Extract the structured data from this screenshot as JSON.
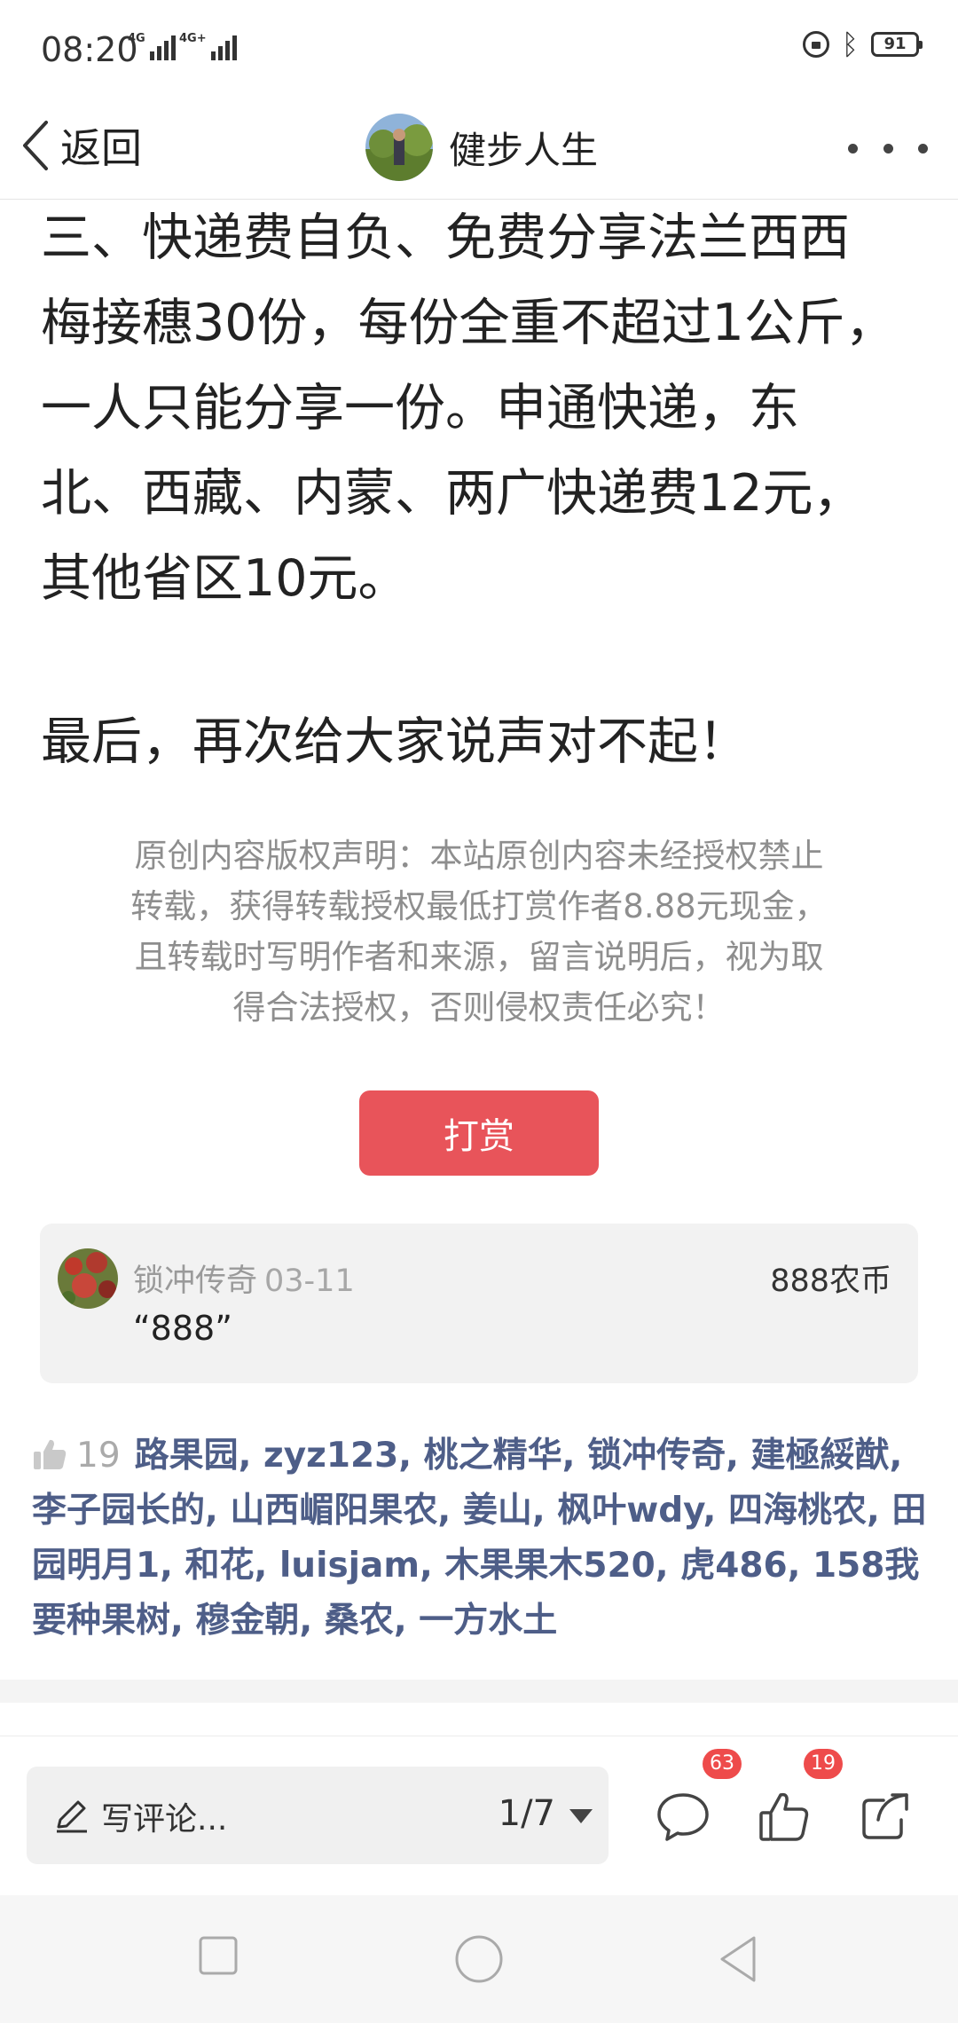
{
  "status_bar": {
    "time": "08:20",
    "net1": "4G",
    "net2": "4G+",
    "battery": "91"
  },
  "nav": {
    "back_label": "返回",
    "title": "健步人生"
  },
  "article": {
    "lines": [
      "三、快递费自负、免费分享法兰西西",
      "梅接穗30份，每份全重不超过1公斤，",
      "一人只能分享一份。申通快递，东",
      "北、西藏、内蒙、两广快递费12元，",
      "其他省区10元。"
    ],
    "closing": "最后，再次给大家说声对不起！"
  },
  "copyright": {
    "line1": "原创内容版权声明：本站原创内容未经授权禁止",
    "line2": "转载，获得转载授权最低打赏作者8.88元现金，",
    "line3": "且转载时写明作者和来源，留言说明后，视为取",
    "line4": "得合法授权，否则侵权责任必究！"
  },
  "tip_button": "打赏",
  "reward_comment": {
    "name": "锁冲传奇",
    "date": "03-11",
    "amount": "888农币",
    "text": "“888”"
  },
  "likes": {
    "count": "19",
    "users": [
      "路果园,",
      "zyz123,",
      "桃之精华,",
      "锁冲传奇,",
      "建極綏猷,",
      "李子园长的,",
      "山西嵋阳果农,",
      "姜山,",
      "枫叶wdy,",
      "四海桃农,",
      "田园明月1,",
      "和花,",
      "luisjam,",
      "木果果木520,",
      "虎486,",
      "158我要种果树,",
      "穆金朝,",
      "桑农,",
      "一方水土"
    ]
  },
  "bottom_bar": {
    "comment_placeholder": "写评论...",
    "page": "1/7",
    "comment_count": "63",
    "like_count": "19"
  },
  "colors": {
    "accent_red": "#e8545a",
    "link_blue": "#4e5e88",
    "badge_red": "#ee4b4b"
  },
  "icons": [
    "back-chevron-icon",
    "more-icon",
    "pen-icon",
    "comment-bubble-icon",
    "thumb-up-icon",
    "share-icon",
    "lock-icon",
    "bluetooth-icon"
  ]
}
